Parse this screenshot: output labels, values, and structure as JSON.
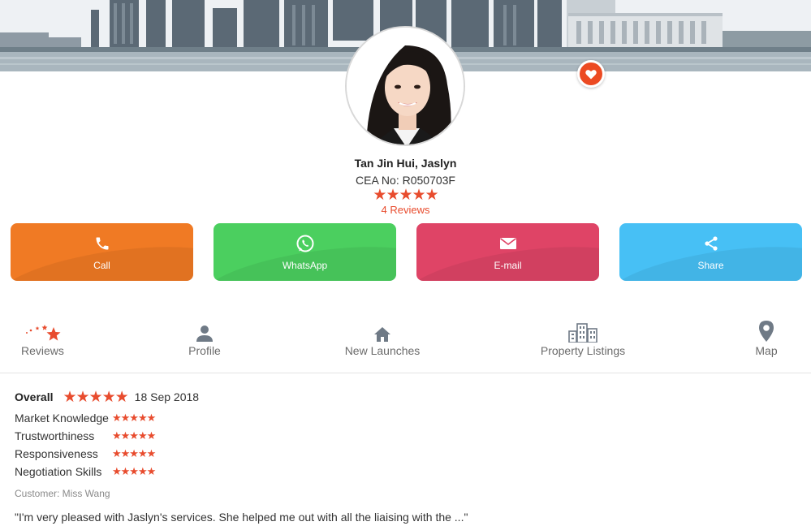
{
  "agent": {
    "name": "Tan Jin Hui, Jaslyn",
    "cea": "CEA No: R050703F",
    "rating_stars": "★★★★★",
    "reviews_link": "4 Reviews"
  },
  "actions": [
    {
      "label": "Call",
      "icon": "phone-icon",
      "color": "#f07a24"
    },
    {
      "label": "WhatsApp",
      "icon": "whatsapp-icon",
      "color": "#4bcf5f"
    },
    {
      "label": "E-mail",
      "icon": "mail-icon",
      "color": "#df4466"
    },
    {
      "label": "Share",
      "icon": "share-icon",
      "color": "#47c0f5"
    }
  ],
  "tabs": [
    {
      "label": "Reviews",
      "icon": "stars-icon",
      "active": true
    },
    {
      "label": "Profile",
      "icon": "person-icon"
    },
    {
      "label": "New Launches",
      "icon": "house-icon"
    },
    {
      "label": "Property Listings",
      "icon": "buildings-icon"
    },
    {
      "label": "Map",
      "icon": "map-pin-icon"
    }
  ],
  "review": {
    "overall_label": "Overall",
    "overall_stars": "★★★★★",
    "date": "18 Sep 2018",
    "criteria": [
      {
        "name": "Market Knowledge",
        "stars": "★★★★★"
      },
      {
        "name": "Trustworthiness",
        "stars": "★★★★★"
      },
      {
        "name": "Responsiveness",
        "stars": "★★★★★"
      },
      {
        "name": "Negotiation Skills",
        "stars": "★★★★★"
      }
    ],
    "customer": "Customer: Miss Wang",
    "quote": "\"I'm very pleased with Jaslyn's services. She helped me out with all the liaising with the ...\""
  },
  "colors": {
    "accent": "#e84c2e",
    "favorite": "#ec4a22",
    "tab_text": "#6b6b6b"
  }
}
